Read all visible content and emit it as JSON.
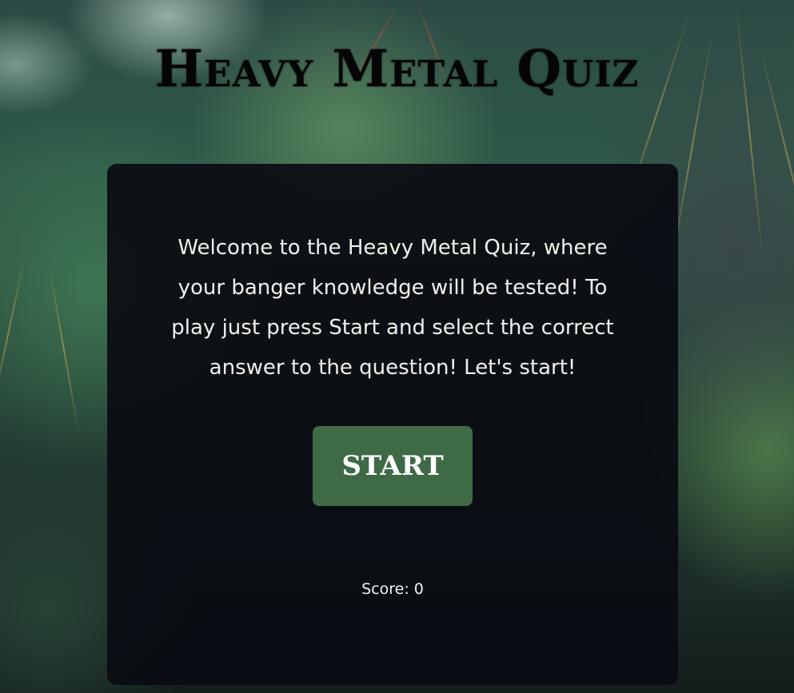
{
  "page": {
    "title": "Heavy Metal Quiz",
    "welcome_text": "Welcome to the Heavy Metal Quiz, where your banger knowledge will be tested! To play just press Start and select the correct answer to the question! Let's start!",
    "start_label": "START",
    "score_label": "Score:",
    "score_value": "0"
  },
  "colors": {
    "card_background": "#0a0c12",
    "start_button": "#3f6a46",
    "text": "#f0f0ec",
    "title": "#050505"
  }
}
